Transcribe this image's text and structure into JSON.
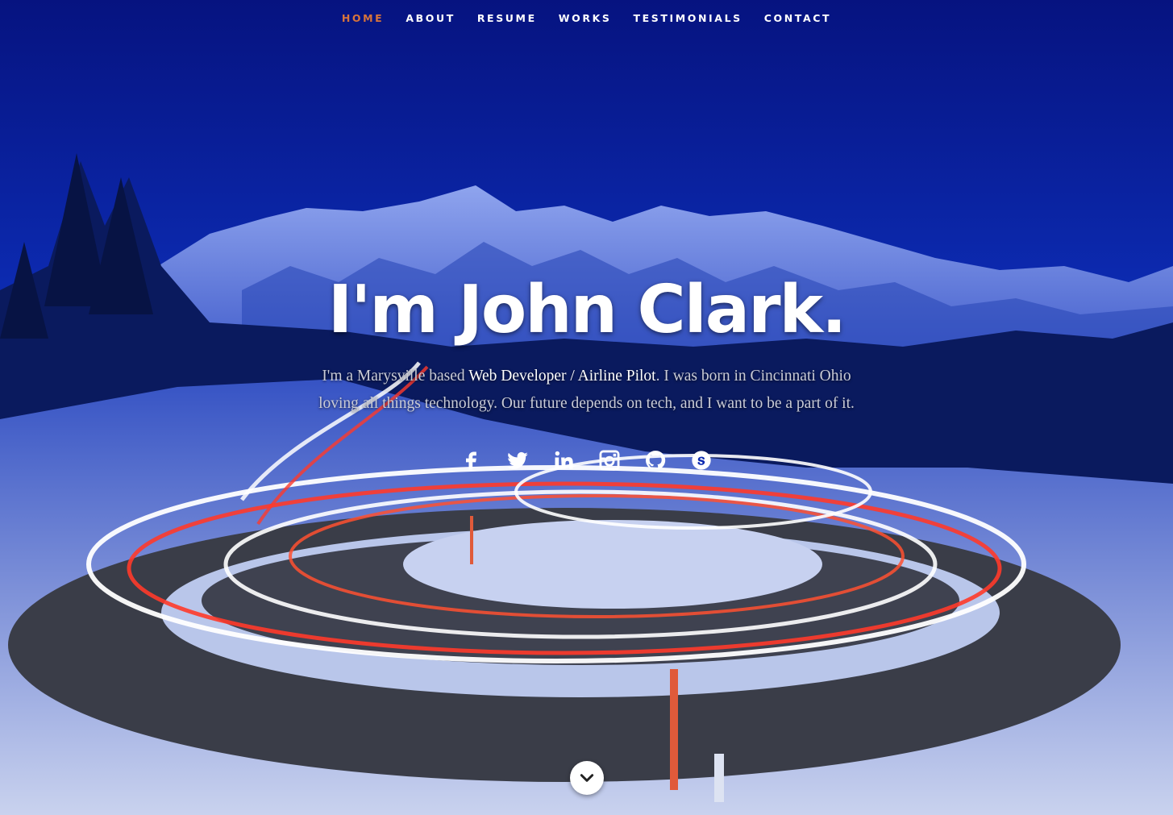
{
  "nav": {
    "items": [
      {
        "label": "HOME",
        "active": true
      },
      {
        "label": "ABOUT",
        "active": false
      },
      {
        "label": "RESUME",
        "active": false
      },
      {
        "label": "WORKS",
        "active": false
      },
      {
        "label": "TESTIMONIALS",
        "active": false
      },
      {
        "label": "CONTACT",
        "active": false
      }
    ],
    "active_color": "#d8743a"
  },
  "hero": {
    "title": "I'm John Clark.",
    "intro_before": "I'm a Marysville based ",
    "highlight": "Web Developer / Airline Pilot",
    "intro_after": ". I was born in Cincinnati Ohio loving all things technology. Our future depends on tech, and I want to be a part of it."
  },
  "social": [
    "facebook-icon",
    "twitter-icon",
    "linkedin-icon",
    "instagram-icon",
    "github-icon",
    "skype-icon"
  ],
  "colors": {
    "sky": "#0a1c8c",
    "accent": "#d8743a",
    "text": "#ffffff"
  }
}
